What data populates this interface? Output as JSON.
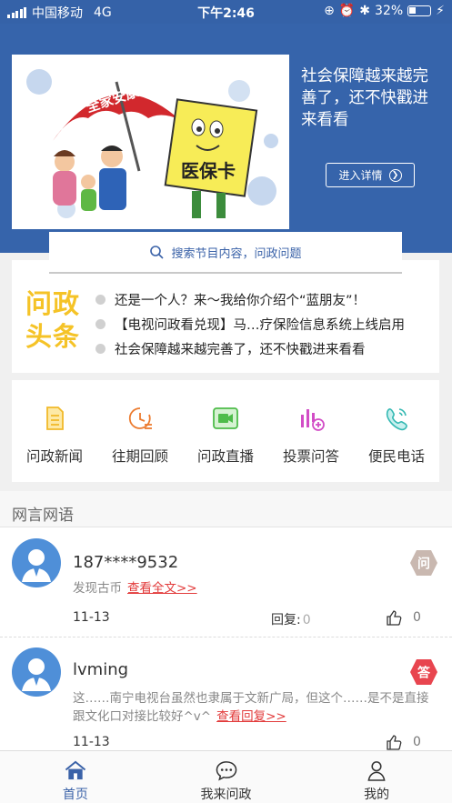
{
  "status_bar": {
    "carrier": "中国移动",
    "network": "4G",
    "time": "下午2:46",
    "battery": "32%"
  },
  "banner": {
    "image_text_umbrella": "全家安康",
    "image_text_card": "医保卡",
    "caption": "社会保障越来越完善了，还不快戳进来看看",
    "detail_button": "进入详情"
  },
  "search": {
    "placeholder": "搜索节目内容，问政问题"
  },
  "headlines": {
    "logo_line1": "问政",
    "logo_line2": "头条",
    "items": [
      "还是一个人？来～我给你介绍个“蓝朋友”！",
      "【电视问政看兑现】马…疗保险信息系统上线启用",
      "社会保障越来越完善了，还不快戳进来看看"
    ]
  },
  "categories": [
    {
      "label": "问政新闻",
      "icon": "document-icon"
    },
    {
      "label": "往期回顾",
      "icon": "history-icon"
    },
    {
      "label": "问政直播",
      "icon": "video-icon"
    },
    {
      "label": "投票问答",
      "icon": "vote-icon"
    },
    {
      "label": "便民电话",
      "icon": "phone-icon"
    }
  ],
  "section": {
    "title": "网言网语"
  },
  "posts": [
    {
      "user": "187****9532",
      "content": "发现古币",
      "link": "查看全文>>",
      "date": "11-13",
      "reply_label": "回复:",
      "reply_count": "0",
      "likes": "0",
      "badge": "问",
      "badge_color": "#c9b8b0"
    },
    {
      "user": "lvming",
      "content": "这……南宁电视台虽然也隶属于文新广局，但这个……是不是直接跟文化口对接比较好^v^",
      "link": "查看回复>>",
      "date": "11-13",
      "likes": "0",
      "badge": "答",
      "badge_color": "#e8454f"
    }
  ],
  "tabbar": [
    {
      "label": "首页",
      "icon": "home-icon",
      "active": true
    },
    {
      "label": "我来问政",
      "icon": "chat-icon",
      "active": false
    },
    {
      "label": "我的",
      "icon": "user-icon",
      "active": false
    }
  ],
  "colors": {
    "primary": "#3664ab",
    "accent_red": "#e23b3b",
    "logo_yellow": "#f5c327"
  }
}
